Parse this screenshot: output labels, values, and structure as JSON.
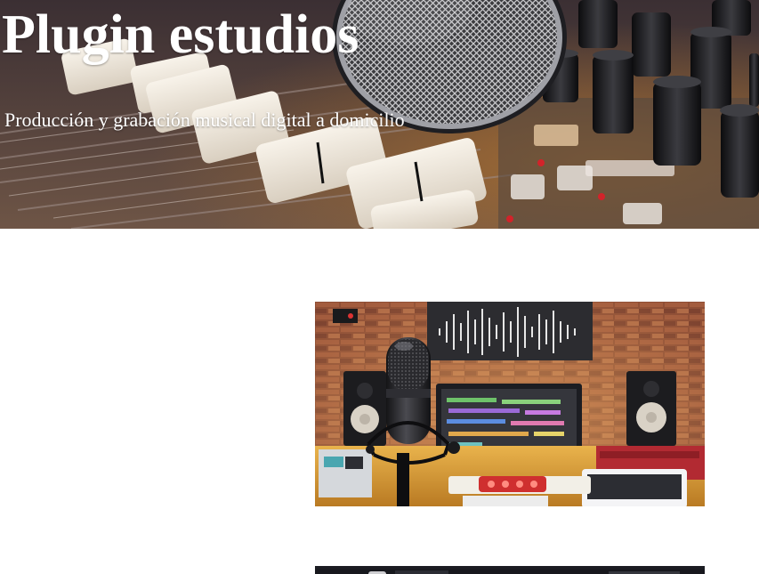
{
  "header": {
    "site_title": "Plugin estudios",
    "tagline": "Producción y grabación musical digital a domicilio"
  },
  "colors": {
    "title_text": "#ffffff",
    "page_background": "#ffffff",
    "hero_dark": "#2a2028",
    "brick": "#8a4a32",
    "desk_wood": "#d8a040"
  },
  "images": {
    "hero": "mixing-console-with-microphone-photo",
    "studio": "studio-microphone-with-monitors-photo",
    "second": "dark-studio-photo"
  }
}
